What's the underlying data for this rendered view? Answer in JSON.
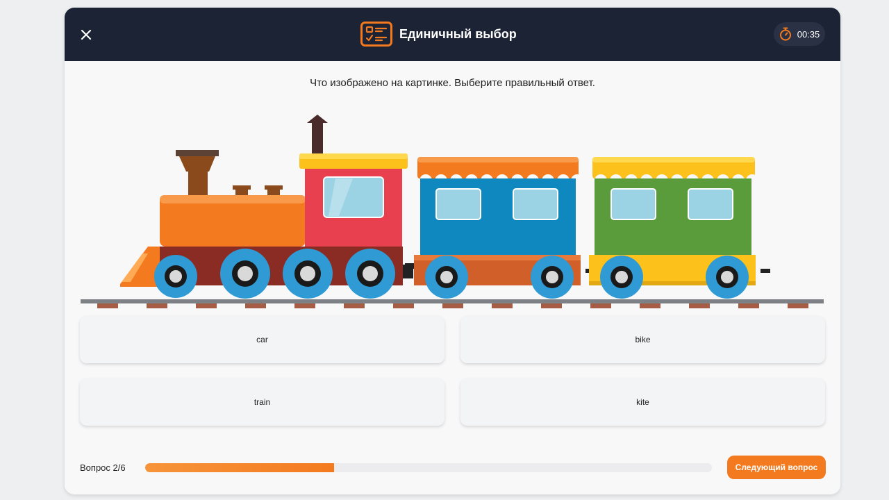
{
  "header": {
    "title": "Единичный выбор",
    "timer": "00:35",
    "icons": {
      "close": "close-icon",
      "quiz": "checklist-icon",
      "timer": "stopwatch-icon"
    },
    "colors": {
      "background": "#1c2334",
      "accent": "#f47a1f"
    }
  },
  "question": {
    "text": "Что изображено на картинке. Выберите правильный ответ.",
    "image": "train-illustration"
  },
  "options": [
    {
      "label": "car"
    },
    {
      "label": "bike"
    },
    {
      "label": "train"
    },
    {
      "label": "kite"
    }
  ],
  "footer": {
    "progress_label": "Вопрос 2/6",
    "progress_fraction": 0.333,
    "next_label": "Следующий вопрос"
  }
}
